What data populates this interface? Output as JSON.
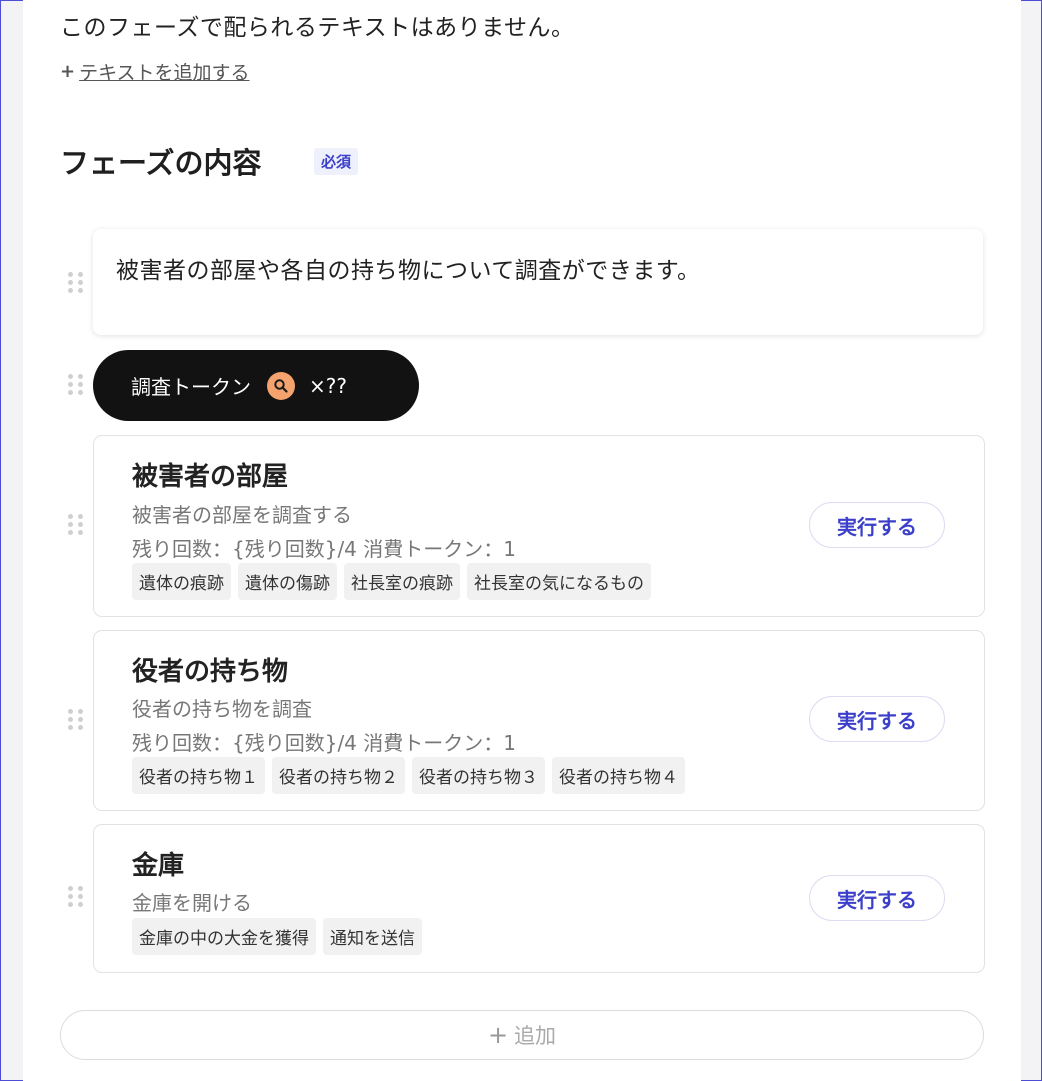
{
  "texts": {
    "no_text_message": "このフェーズで配られるテキストはありません。",
    "add_text_plus": "+",
    "add_text_link": "テキストを追加する"
  },
  "section": {
    "title": "フェーズの内容",
    "required_badge": "必須"
  },
  "description": {
    "text": "被害者の部屋や各自の持ち物について調査ができます。"
  },
  "token": {
    "label": "調査トークン",
    "icon": "search-icon",
    "icon_bg": "#f4a26e",
    "count": "×??"
  },
  "actions": [
    {
      "title": "被害者の部屋",
      "description": "被害者の部屋を調査する",
      "meta": "残り回数：{残り回数}/4 消費トークン：1",
      "tags": [
        "遺体の痕跡",
        "遺体の傷跡",
        "社長室の痕跡",
        "社長室の気になるもの"
      ],
      "button": "実行する"
    },
    {
      "title": "役者の持ち物",
      "description": "役者の持ち物を調査",
      "meta": "残り回数：{残り回数}/4 消費トークン：1",
      "tags": [
        "役者の持ち物１",
        "役者の持ち物２",
        "役者の持ち物３",
        "役者の持ち物４"
      ],
      "button": "実行する"
    },
    {
      "title": "金庫",
      "description": "金庫を開ける",
      "tags": [
        "金庫の中の大金を獲得",
        "通知を送信"
      ],
      "button": "実行する"
    }
  ],
  "add_button": {
    "plus": "+",
    "label": "追加"
  },
  "colors": {
    "accent": "#3b3fc9",
    "frame_border": "#4d4dd6",
    "pill_bg": "#121212"
  }
}
